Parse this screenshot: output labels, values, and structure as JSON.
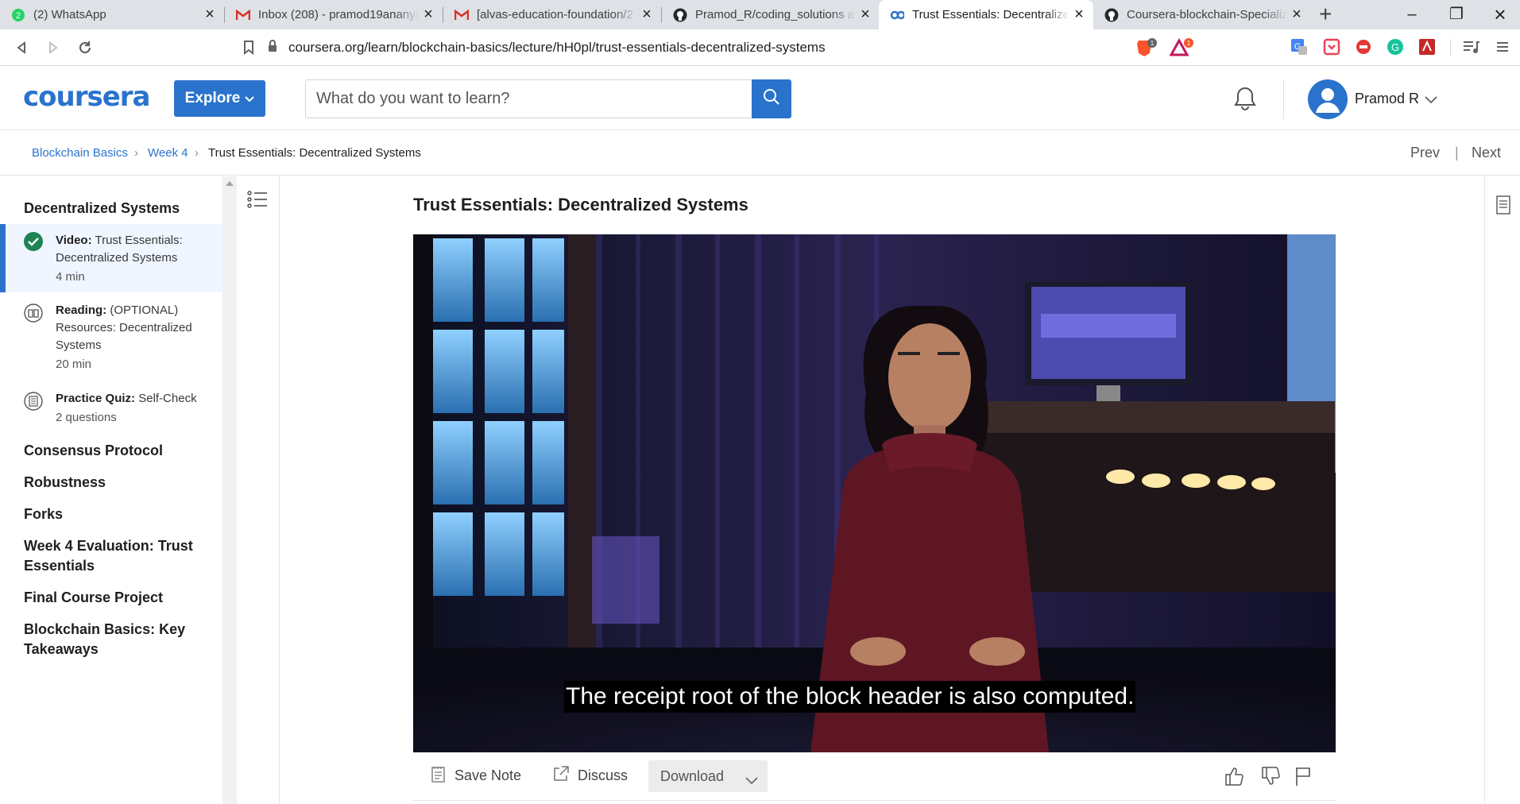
{
  "browser": {
    "tabs": [
      {
        "title": "(2) WhatsApp",
        "icon": "whatsapp-icon"
      },
      {
        "title": "Inbox (208) - pramod19ananya",
        "icon": "gmail-icon"
      },
      {
        "title": "[alvas-education-foundation/2",
        "icon": "gmail-icon"
      },
      {
        "title": "Pramod_R/coding_solutions at",
        "icon": "github-icon"
      },
      {
        "title": "Trust Essentials: Decentralized",
        "icon": "coursera-icon",
        "active": true
      },
      {
        "title": "Coursera-blockchain-Specializ",
        "icon": "github-icon"
      }
    ],
    "url": "coursera.org/learn/blockchain-basics/lecture/hH0pl/trust-essentials-decentralized-systems",
    "badges": {
      "brave": "1",
      "alert": "1"
    }
  },
  "header": {
    "logo": "coursera",
    "explore_label": "Explore",
    "search_placeholder": "What do you want to learn?",
    "user_name": "Pramod R"
  },
  "breadcrumb": {
    "course": "Blockchain Basics",
    "week": "Week 4",
    "current": "Trust Essentials: Decentralized Systems",
    "prev": "Prev",
    "next": "Next"
  },
  "sidebar": {
    "module_title": "Decentralized Systems",
    "items": [
      {
        "kind": "Video:",
        "title": "Trust Essentials: Decentralized Systems",
        "meta": "4 min",
        "status": "completed"
      },
      {
        "kind": "Reading:",
        "title": "(OPTIONAL) Resources: Decentralized Systems",
        "meta": "20 min",
        "status": "reading"
      },
      {
        "kind": "Practice Quiz:",
        "title": "Self-Check",
        "meta": "2 questions",
        "status": "quiz"
      }
    ],
    "sections": [
      "Consensus Protocol",
      "Robustness",
      "Forks",
      "Week 4 Evaluation: Trust Essentials",
      "Final Course Project",
      "Blockchain Basics: Key Takeaways"
    ]
  },
  "lecture": {
    "title": "Trust Essentials: Decentralized Systems",
    "caption": "The receipt root of the block header is also computed."
  },
  "actions": {
    "save_note": "Save Note",
    "discuss": "Discuss",
    "download": "Download"
  },
  "colors": {
    "brand": "#2a73cc",
    "completed": "#1f8354"
  }
}
